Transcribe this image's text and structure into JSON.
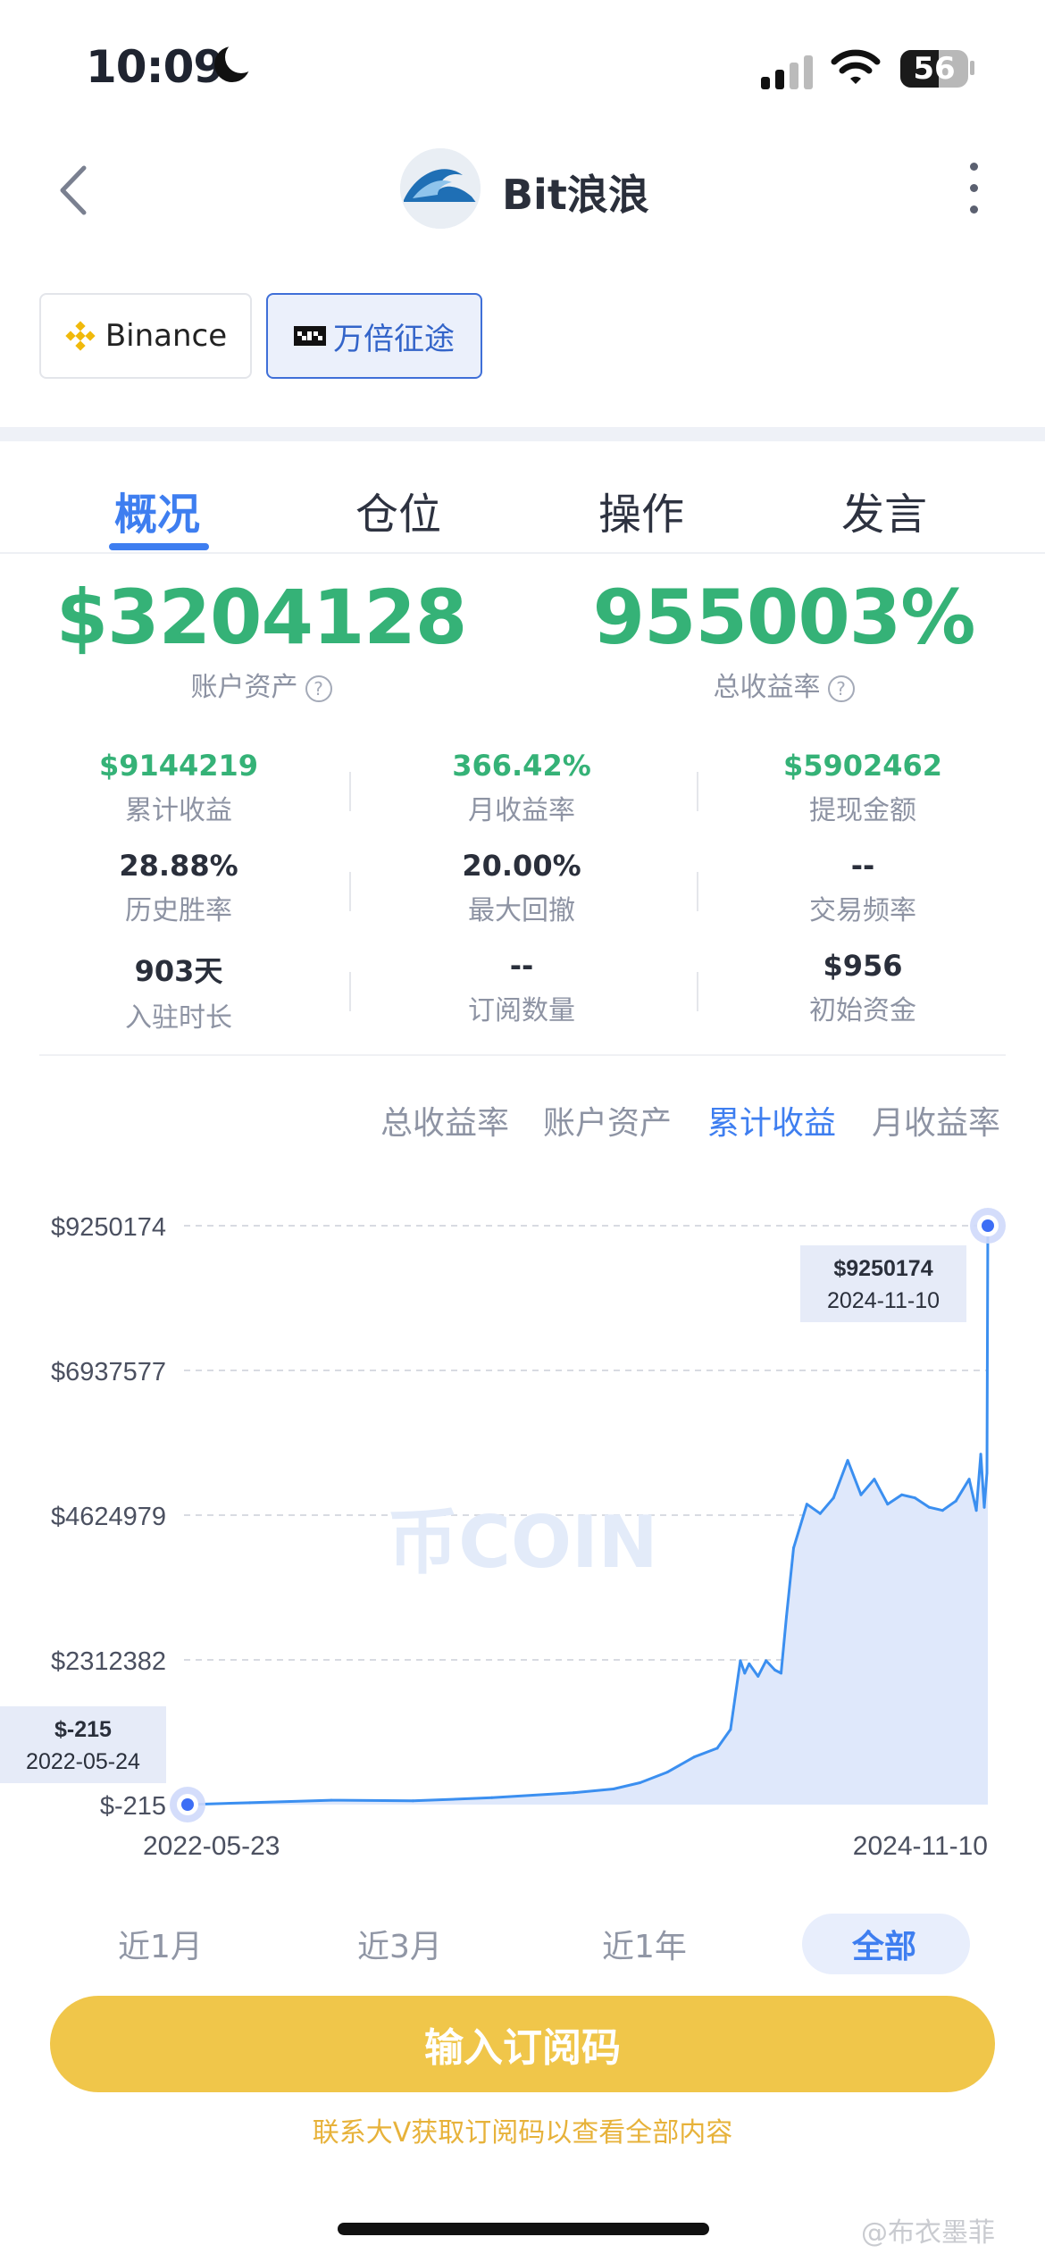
{
  "status_bar": {
    "time": "10:09",
    "battery": "56",
    "battery_fraction": 0.56
  },
  "header": {
    "title": "Bit浪浪"
  },
  "exchanges": [
    {
      "label": "Binance"
    },
    {
      "label": "万倍征途"
    }
  ],
  "tabs": [
    {
      "label": "概况",
      "active": true
    },
    {
      "label": "仓位"
    },
    {
      "label": "操作"
    },
    {
      "label": "发言"
    }
  ],
  "summary": {
    "account_assets": {
      "value": "$3204128",
      "label": "账户资产"
    },
    "total_return": {
      "value": "955003%",
      "label": "总收益率"
    }
  },
  "stats": [
    [
      {
        "value": "$9144219",
        "label": "累计收益",
        "tone": "green"
      },
      {
        "value": "366.42%",
        "label": "月收益率",
        "tone": "green"
      },
      {
        "value": "$5902462",
        "label": "提现金额",
        "tone": "green"
      }
    ],
    [
      {
        "value": "28.88%",
        "label": "历史胜率",
        "tone": "dark"
      },
      {
        "value": "20.00%",
        "label": "最大回撤",
        "tone": "dark"
      },
      {
        "value": "--",
        "label": "交易频率",
        "tone": "dark"
      }
    ],
    [
      {
        "value": "903天",
        "label": "入驻时长",
        "tone": "dark"
      },
      {
        "value": "--",
        "label": "订阅数量",
        "tone": "dark"
      },
      {
        "value": "$956",
        "label": "初始资金",
        "tone": "dark"
      }
    ]
  ],
  "chart_tabs": [
    {
      "label": "总收益率"
    },
    {
      "label": "账户资产"
    },
    {
      "label": "累计收益",
      "active": true
    },
    {
      "label": "月收益率"
    }
  ],
  "chart_watermark": "币COIN",
  "chart_data": {
    "type": "area",
    "y_ticks": [
      "$9250174",
      "$6937577",
      "$4624979",
      "$2312382",
      "$-215"
    ],
    "ylim": [
      -215,
      9250174
    ],
    "x_ticks": [
      "2022-05-23",
      "2024-11-10"
    ],
    "x": [
      "2022-05-23",
      "2022-08-01",
      "2022-11-01",
      "2023-02-01",
      "2023-05-01",
      "2023-08-01",
      "2023-09-15",
      "2023-10-15",
      "2023-11-15",
      "2023-12-15",
      "2024-01-10",
      "2024-01-25",
      "2024-02-05",
      "2024-02-10",
      "2024-02-15",
      "2024-02-25",
      "2024-03-05",
      "2024-03-15",
      "2024-03-22",
      "2024-03-28",
      "2024-04-05",
      "2024-04-20",
      "2024-05-05",
      "2024-05-20",
      "2024-06-05",
      "2024-06-20",
      "2024-07-05",
      "2024-07-20",
      "2024-08-05",
      "2024-08-20",
      "2024-09-05",
      "2024-09-20",
      "2024-10-05",
      "2024-10-20",
      "2024-10-28",
      "2024-11-02",
      "2024-11-06",
      "2024-11-09",
      "2024-11-10"
    ],
    "values": [
      -215,
      30000,
      70000,
      60000,
      110000,
      190000,
      250000,
      350000,
      520000,
      760000,
      900000,
      1200000,
      2300000,
      2100000,
      2250000,
      2050000,
      2300000,
      2150000,
      2100000,
      3000000,
      4100000,
      4800000,
      4650000,
      4900000,
      5500000,
      4950000,
      5200000,
      4800000,
      4950000,
      4900000,
      4750000,
      4700000,
      4850000,
      5200000,
      4700000,
      5600000,
      4750000,
      5300000,
      9250174
    ],
    "tooltips": [
      {
        "value": "$9250174",
        "date": "2024-11-10"
      },
      {
        "value": "$-215",
        "date": "2022-05-24"
      }
    ],
    "colors": {
      "line": "#3b8ff0",
      "fill": "#dfe8fb",
      "marker": "#3d6ef5"
    }
  },
  "ranges": [
    {
      "label": "近1月"
    },
    {
      "label": "近3月"
    },
    {
      "label": "近1年"
    },
    {
      "label": "全部",
      "active": true
    }
  ],
  "cta": {
    "label": "输入订阅码",
    "hint": "联系大V获取订阅码以查看全部内容"
  },
  "footer": {
    "weibo": "@布衣墨菲"
  }
}
